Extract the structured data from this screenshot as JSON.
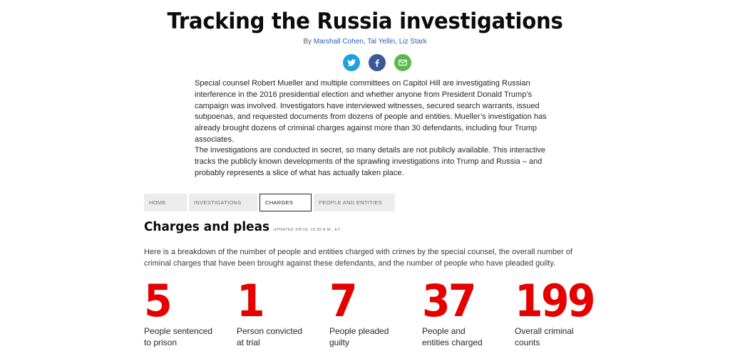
{
  "header": {
    "title": "Tracking the Russia investigations",
    "byline_prefix": "By",
    "authors": [
      "Marshall Cohen",
      "Tal Yellin",
      "Liz Stark"
    ],
    "author_sep": ", "
  },
  "share": [
    {
      "name": "twitter-share-button",
      "icon": "twitter-icon",
      "color": "#1ea1df"
    },
    {
      "name": "facebook-share-button",
      "icon": "facebook-icon",
      "color": "#3a5998"
    },
    {
      "name": "email-share-button",
      "icon": "email-icon",
      "color": "#5bb94c"
    }
  ],
  "intro": {
    "p1": "Special counsel Robert Mueller and multiple committees on Capitol Hill are investigating Russian interference in the 2016 presidential election and whether anyone from President Donald Trump’s campaign was involved. Investigators have interviewed witnesses, secured search warrants, issued subpoenas, and requested documents from dozens of people and entities. Mueller’s investigation has already brought dozens of criminal charges against more than 30 defendants, including four Trump associates.",
    "p2": "The investigations are conducted in secret, so many details are not publicly available. This interactive tracks the publicly known developments of the sprawling investigations into Trump and Russia – and probably represents a slice of what has actually taken place."
  },
  "tabs": [
    {
      "label": "HOME",
      "active": false
    },
    {
      "label": "INVESTIGATIONS",
      "active": false
    },
    {
      "label": "CHARGES",
      "active": true
    },
    {
      "label": "PEOPLE AND ENTITIES",
      "active": false
    }
  ],
  "section": {
    "title": "Charges and pleas",
    "updated": "UPDATED 3/8/19, 10:30 A.M., ET.",
    "lead": "Here is a breakdown of the number of people and entities charged with crimes by the special counsel, the overall number of criminal charges that have been brought against these defendants, and the number of people who have pleaded guilty."
  },
  "stats": [
    {
      "value": "5",
      "label_line1": "People sentenced",
      "label_line2": "to prison"
    },
    {
      "value": "1",
      "label_line1": "Person convicted",
      "label_line2": "at trial"
    },
    {
      "value": "7",
      "label_line1": "People pleaded",
      "label_line2": "guilty"
    },
    {
      "value": "37",
      "label_line1": "People and",
      "label_line2": "entities charged"
    },
    {
      "value": "199",
      "label_line1": "Overall criminal",
      "label_line2": "counts"
    }
  ],
  "colors": {
    "accent_red": "#e60000",
    "link_blue": "#2b5fb8",
    "tab_bg": "#ececec"
  }
}
